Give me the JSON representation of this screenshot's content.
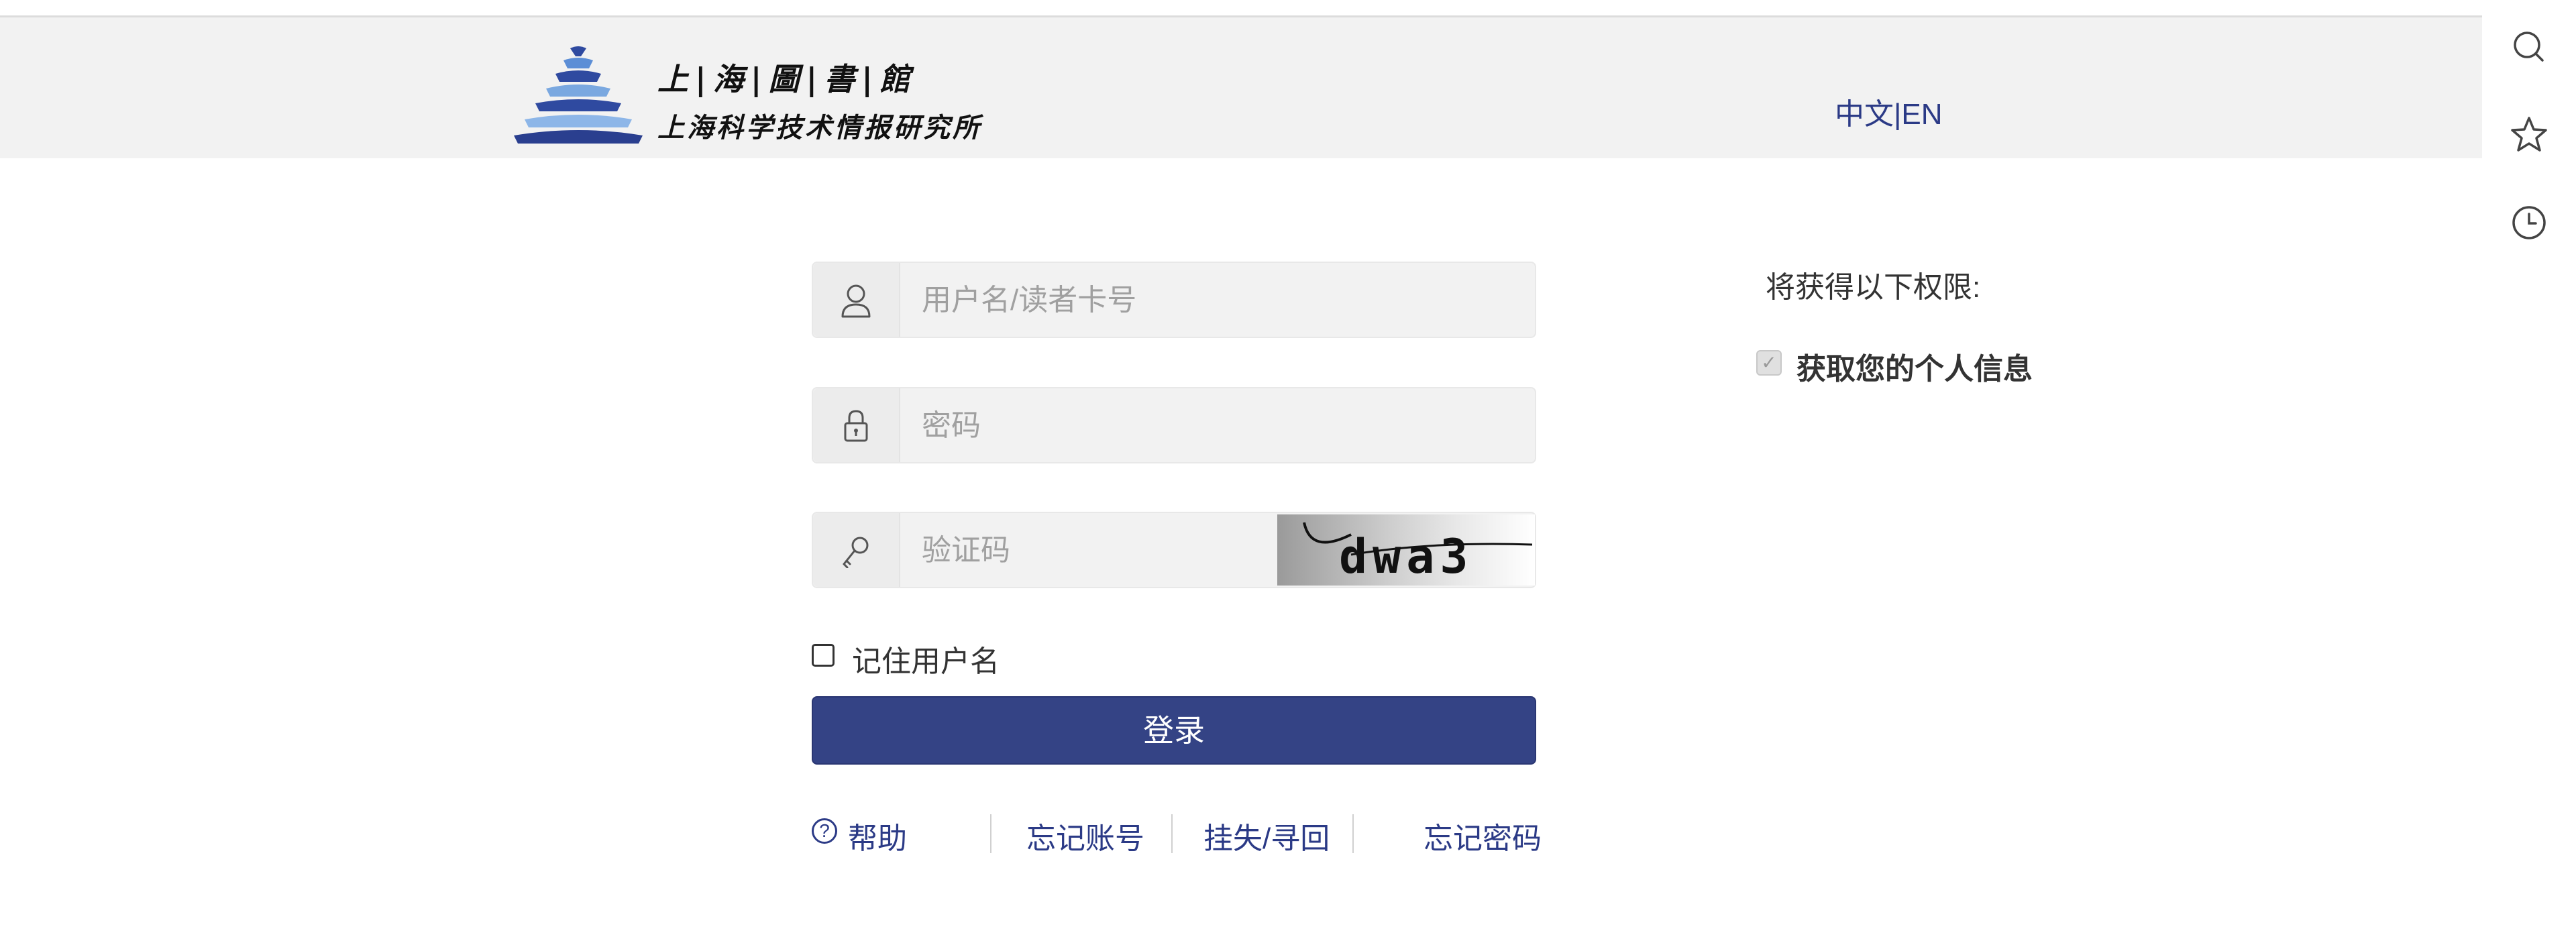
{
  "header": {
    "logo_line1": "上|海|圖|書|館",
    "logo_line2": "上海科学技术情报研究所",
    "language_switch": "中文|EN"
  },
  "side_toolbar": {
    "icons": [
      "search-icon",
      "star-icon",
      "clock-icon"
    ]
  },
  "login_form": {
    "username_placeholder": "用户名/读者卡号",
    "password_placeholder": "密码",
    "captcha_placeholder": "验证码",
    "captcha_text": "dwa3",
    "remember_label": "记住用户名",
    "remember_checked": false,
    "login_button": "登录"
  },
  "links": {
    "help": "帮助",
    "forgot_account": "忘记账号",
    "report_loss": "挂失/寻回",
    "forgot_password": "忘记密码"
  },
  "permissions": {
    "title": "将获得以下权限:",
    "items": [
      {
        "label": "获取您的个人信息",
        "checked": true,
        "disabled": true
      }
    ]
  },
  "colors": {
    "primary": "#344385",
    "link": "#2b3a86",
    "header_bg": "#f2f2f2"
  }
}
